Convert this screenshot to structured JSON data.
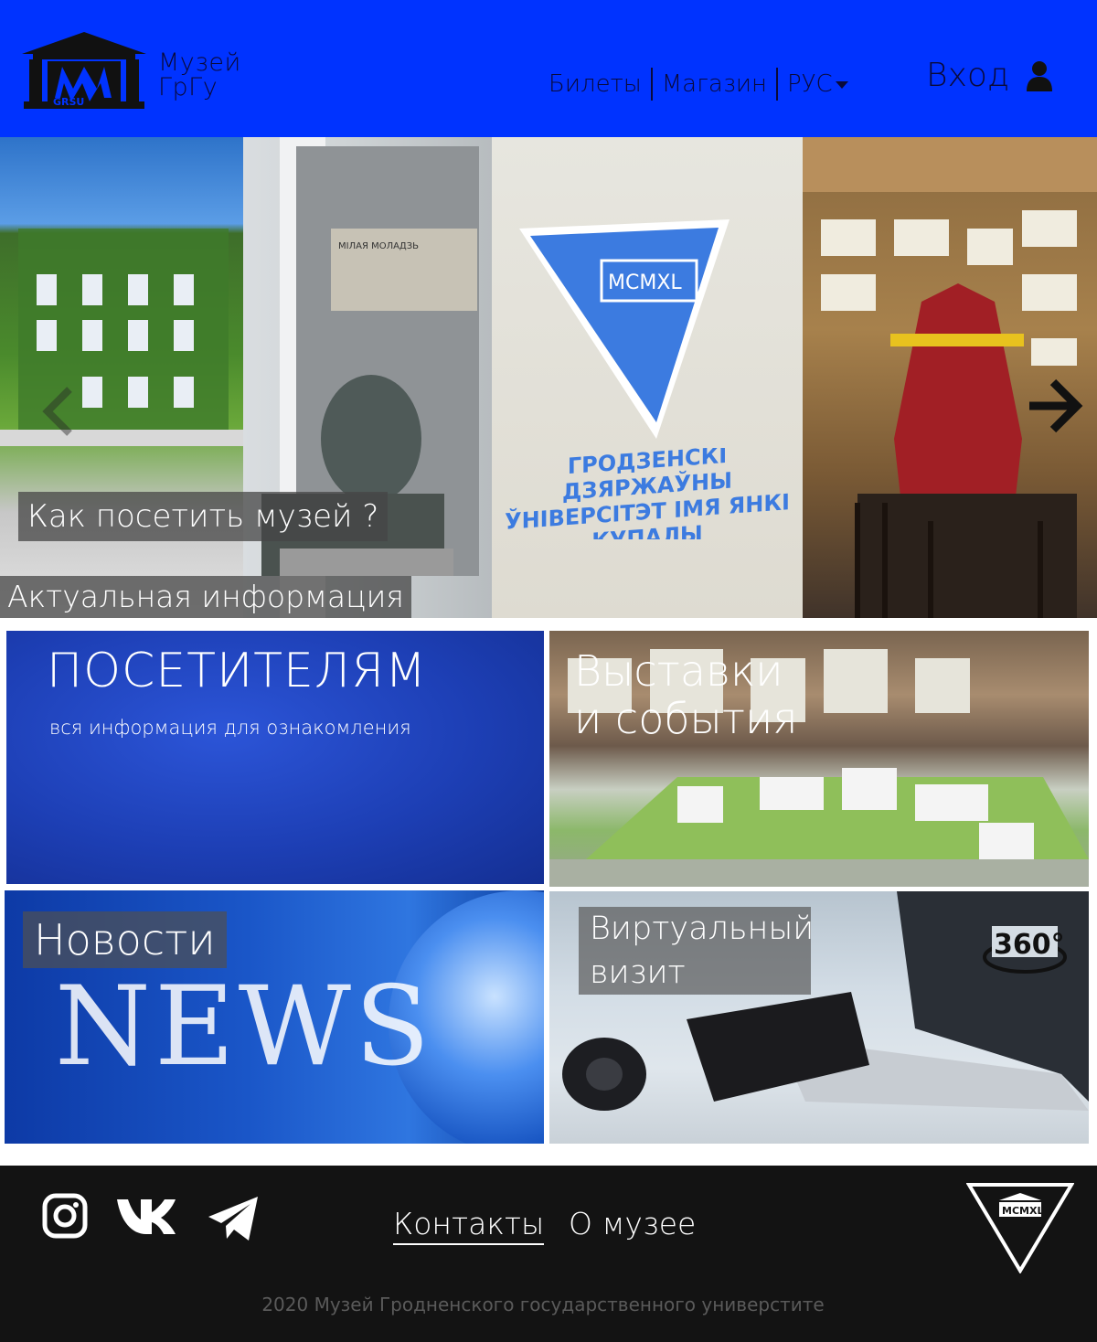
{
  "header": {
    "logo_text": "GRSU",
    "brand_line1": "Музей",
    "brand_line2": "ГрГу",
    "nav": {
      "tickets": "Билеты",
      "shop": "Магазин",
      "language": "РУС"
    },
    "login_label": "Вход"
  },
  "hero": {
    "panel_texts": {
      "monument": "МІЛАЯ МОЛАДЗЬ",
      "emblem": "MCMXL",
      "emblem_caption": "ГРОДЗЕНСКІ ДЗЯРЖАЎНЫ ЎНІВЕРСІТЭТ ІМЯ ЯНКІ КУПАЛЫ"
    },
    "caption_visit": "Как посетить музей ?",
    "caption_actual": "Актуальная информация"
  },
  "tiles": {
    "visitors": {
      "title": "ПОСЕТИТЕЛЯМ",
      "subtitle": "вся информация для ознакомления"
    },
    "exhibitions": {
      "title_line1": "Выставки",
      "title_line2": "и события"
    },
    "news": {
      "title": "Новости",
      "image_word": "NEWS"
    },
    "virtual": {
      "title_line1": "Виртуальный",
      "title_line2": "визит",
      "badge": "360°"
    }
  },
  "footer": {
    "links": {
      "contacts": "Контакты",
      "about": "О музее"
    },
    "logo_text": "MCMXL",
    "copyright": "2020 Музей Гродненского государственного универстите"
  },
  "colors": {
    "header_bg": "#0033ff",
    "footer_bg": "#131313",
    "text_dark": "#0a0a3a"
  }
}
